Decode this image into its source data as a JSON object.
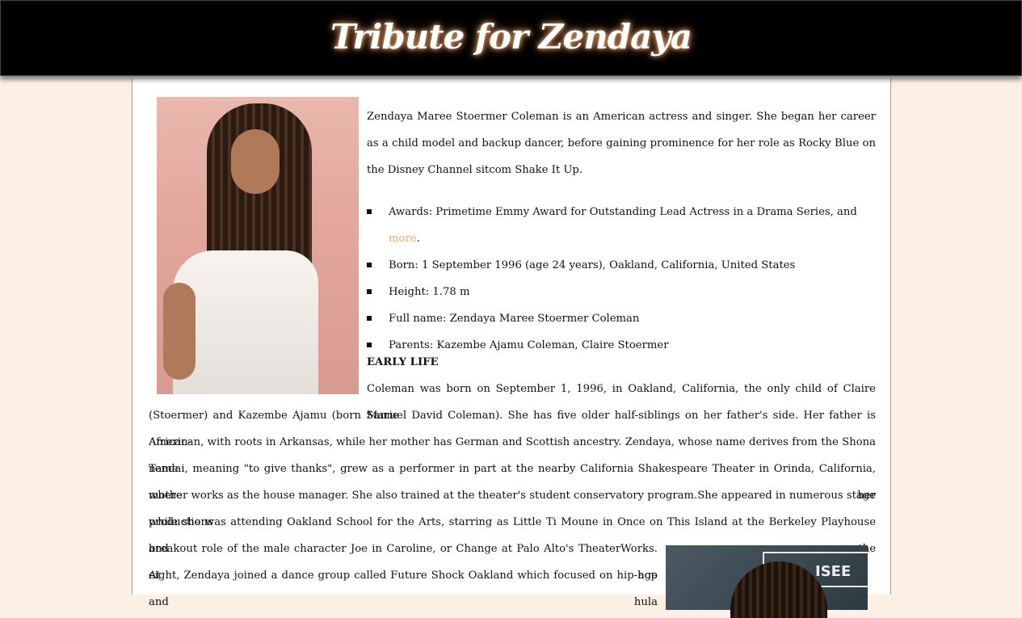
{
  "header": {
    "title": "Tribute for Zendaya"
  },
  "intro": "Zendaya Maree Stoermer Coleman is an American actress and singer. She began her career as a child model and backup dancer, before gaining prominence for her role as Rocky Blue on the Disney Channel sitcom Shake It Up.",
  "facts": {
    "awards_prefix": "Awards: Primetime Emmy Award for Outstanding Lead Actress in a Drama Series, and ",
    "awards_link": "more",
    "awards_suffix": ".",
    "born": "Born: 1 September 1996 (age 24 years), Oakland, California, United States",
    "height": "Height: 1.78 m",
    "full_name": "Full name: Zendaya Maree Stoermer Coleman",
    "parents": "Parents: Kazembe Ajamu Coleman, Claire Stoermer"
  },
  "early_life": {
    "heading": "EARLY LIFE",
    "line1": "Coleman was born on September 1, 1996, in Oakland, California, the only child of Claire Marie",
    "line2": "(Stoermer) and Kazembe Ajamu (born Samuel David Coleman). She has five older half-siblings on her father's side. Her father is African-",
    "line3": "American, with roots in Arkansas, while her mother has German and Scottish ancestry. Zendaya, whose name derives from the Shona name",
    "line4": "Tendai, meaning \"to give thanks\", grew as a performer in part at the nearby California Shakespeare Theater in Orinda, California, where her",
    "line5": "mother works as the house manager. She also trained at the theater's student conservatory program.She appeared in numerous stage productions",
    "line6": "while she was attending Oakland School for the Arts, starring as Little Ti Moune in Once on This Island at the Berkeley Playhouse and the",
    "line7": "breakout role of the male character Joe in Caroline, or Change at Palo Alto's TheaterWorks. At age",
    "line8": "eight, Zendaya joined a dance group called Future Shock Oakland which focused on hip-hop and hula"
  },
  "photo2": {
    "sign_text": "ISEE"
  }
}
